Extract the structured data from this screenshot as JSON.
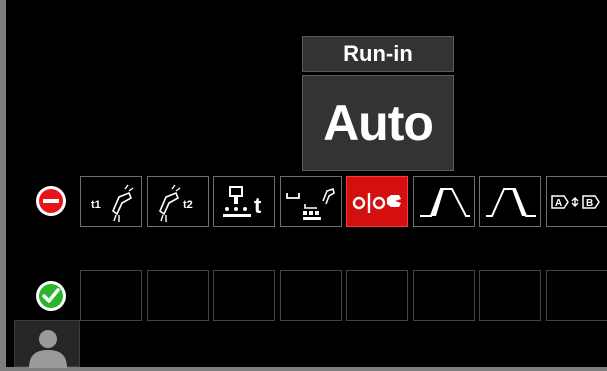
{
  "panel": {
    "title": "Run-in",
    "value": "Auto"
  },
  "status": {
    "disabled_icon": "no-entry-icon",
    "enabled_icon": "checkmark-icon",
    "user_icon": "user-profile-icon"
  },
  "colors": {
    "background": "#000000",
    "active_slot": "#d40f0f",
    "disabled": "#e8141c",
    "enabled": "#2bb52b",
    "panel": "#333333"
  },
  "disabled_row": {
    "items": [
      {
        "icon": "preflow-torch-icon",
        "label": "t1"
      },
      {
        "icon": "postflow-torch-icon",
        "label": "t2"
      },
      {
        "icon": "spot-timer-icon",
        "label": "t"
      },
      {
        "icon": "crater-fill-icon",
        "label": ""
      },
      {
        "icon": "run-in-icon",
        "label": "",
        "selected": true
      },
      {
        "icon": "start-procedure-icon",
        "label": ""
      },
      {
        "icon": "end-procedure-icon",
        "label": ""
      },
      {
        "icon": "procedure-ab-icon",
        "label": ""
      }
    ]
  },
  "enabled_row": {
    "items": [
      {
        "icon": "empty-slot"
      },
      {
        "icon": "empty-slot"
      },
      {
        "icon": "empty-slot"
      },
      {
        "icon": "empty-slot"
      },
      {
        "icon": "empty-slot"
      },
      {
        "icon": "empty-slot"
      },
      {
        "icon": "empty-slot"
      },
      {
        "icon": "empty-slot"
      }
    ]
  }
}
